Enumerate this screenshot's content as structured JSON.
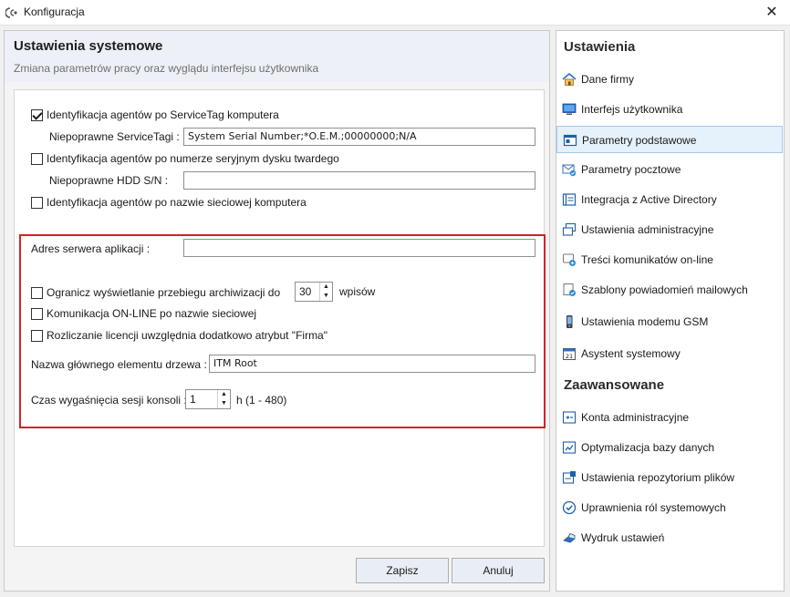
{
  "window": {
    "title": "Konfiguracja",
    "close": "✕"
  },
  "main": {
    "title": "Ustawienia systemowe",
    "subtitle": "Zmiana parametrów pracy oraz wyglądu interfejsu użytkownika",
    "servicetag_check": {
      "label": "Identyfikacja agentów po ServiceTag komputera",
      "checked": true
    },
    "servicetag_invalid": {
      "label": "Niepoprawne ServiceTagi :",
      "value": "System Serial Number;*O.E.M.;00000000;N/A"
    },
    "hdd_check": {
      "label": "Identyfikacja agentów po numerze seryjnym dysku twardego",
      "checked": false
    },
    "hdd_invalid": {
      "label": "Niepoprawne HDD S/N :",
      "value": ""
    },
    "netname_check": {
      "label": "Identyfikacja agentów po nazwie sieciowej komputera",
      "checked": false
    },
    "server_address": {
      "label": "Adres serwera aplikacji :",
      "value": ""
    },
    "limit_archive": {
      "label": "Ogranicz wyświetlanie przebiegu archiwizacji do",
      "value": "30",
      "unit": "wpisów",
      "checked": false
    },
    "online_comm": {
      "label": "Komunikacja ON-LINE po nazwie sieciowej",
      "checked": false
    },
    "license_firma": {
      "label": "Rozliczanie licencji uwzględnia dodatkowo atrybut \"Firma\"",
      "checked": false
    },
    "tree_root": {
      "label": "Nazwa głównego elementu drzewa :",
      "value": "ITM Root"
    },
    "session_timeout": {
      "label": "Czas wygaśnięcia sesji konsoli :",
      "value": "1",
      "unit": "h (1 - 480)"
    },
    "buttons": {
      "save": "Zapisz",
      "cancel": "Anuluj"
    }
  },
  "nav": {
    "section1": "Ustawienia",
    "items1": [
      {
        "label": "Dane firmy",
        "icon": "home-icon"
      },
      {
        "label": "Interfejs użytkownika",
        "icon": "monitor-icon"
      },
      {
        "label": "Parametry podstawowe",
        "icon": "window-icon",
        "selected": true
      },
      {
        "label": "Parametry pocztowe",
        "icon": "mail-check-icon"
      },
      {
        "label": "Integracja z Active Directory",
        "icon": "directory-icon"
      },
      {
        "label": "Ustawienia administracyjne",
        "icon": "windows-icon"
      },
      {
        "label": "Treści komunikatów on-line",
        "icon": "message-icon"
      },
      {
        "label": "Szablony powiadomień mailowych",
        "icon": "mail-template-icon"
      },
      {
        "label": "Ustawienia modemu GSM",
        "icon": "phone-icon"
      },
      {
        "label": "Asystent systemowy",
        "icon": "calendar-icon"
      }
    ],
    "section2": "Zaawansowane",
    "items2": [
      {
        "label": "Konta administracyjne",
        "icon": "admin-accounts-icon"
      },
      {
        "label": "Optymalizacja bazy danych",
        "icon": "database-icon"
      },
      {
        "label": "Ustawienia repozytorium plików",
        "icon": "repository-icon"
      },
      {
        "label": "Uprawnienia ról systemowych",
        "icon": "roles-icon"
      },
      {
        "label": "Wydruk ustawień",
        "icon": "print-icon"
      }
    ]
  },
  "colors": {
    "accent": "#1d6fc9",
    "highlight": "#d6202a",
    "selected_bg": "#e5f1fb"
  }
}
